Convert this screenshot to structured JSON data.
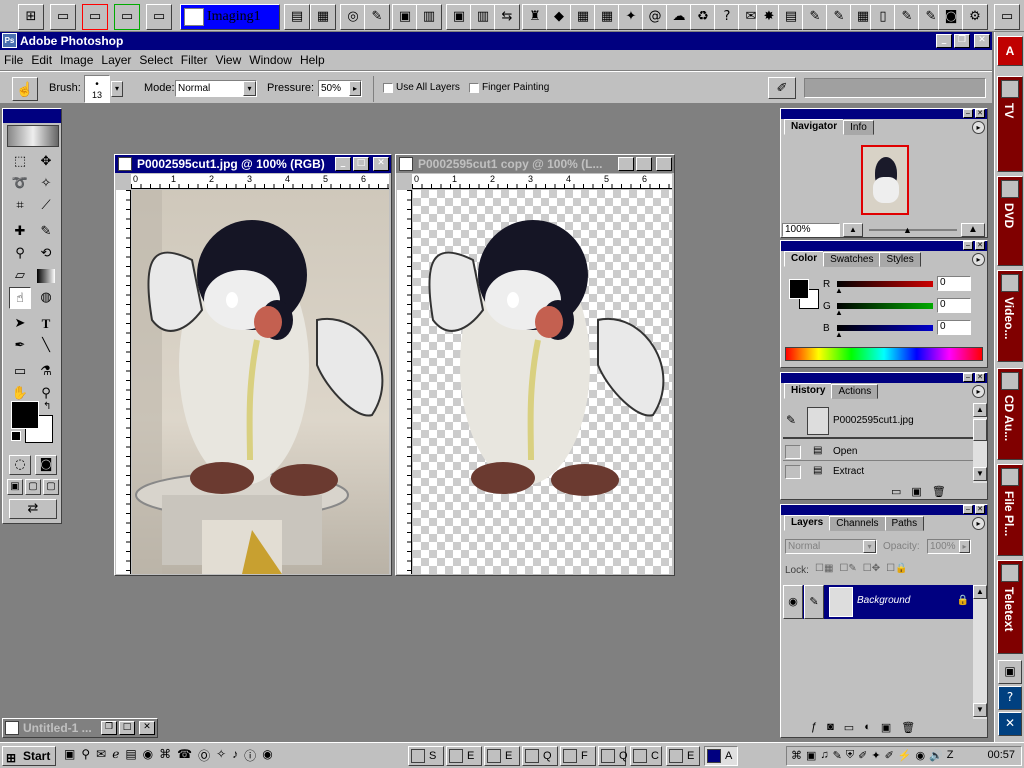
{
  "top_shortcut_bar": {
    "active_folder_label": "Imaging1"
  },
  "app": {
    "title": "Adobe Photoshop",
    "menu": [
      "File",
      "Edit",
      "Image",
      "Layer",
      "Select",
      "Filter",
      "View",
      "Window",
      "Help"
    ]
  },
  "options_bar": {
    "brush_label": "Brush:",
    "brush_size": "13",
    "mode_label": "Mode:",
    "mode_value": "Normal",
    "pressure_label": "Pressure:",
    "pressure_value": "50%",
    "use_all_layers_label": "Use All Layers",
    "use_all_layers_checked": false,
    "finger_painting_label": "Finger Painting",
    "finger_painting_checked": false
  },
  "documents": [
    {
      "title": "P0002595cut1.jpg @ 100% (RGB)",
      "active": true
    },
    {
      "title": "P0002595cut1 copy @ 100% (L...",
      "active": false
    }
  ],
  "ruler_numbers": [
    "0",
    "1",
    "2",
    "3",
    "4",
    "5",
    "6"
  ],
  "navigator": {
    "tabs": [
      "Navigator",
      "Info"
    ],
    "zoom": "100%"
  },
  "color": {
    "tabs": [
      "Color",
      "Swatches",
      "Styles"
    ],
    "channels": [
      {
        "label": "R",
        "value": "0",
        "color": "#cc0000"
      },
      {
        "label": "G",
        "value": "0",
        "color": "#00aa00"
      },
      {
        "label": "B",
        "value": "0",
        "color": "#0000cc"
      }
    ]
  },
  "history": {
    "tabs": [
      "History",
      "Actions"
    ],
    "snapshot": "P0002595cut1.jpg",
    "steps": [
      "Open",
      "Extract"
    ]
  },
  "layers": {
    "tabs": [
      "Layers",
      "Channels",
      "Paths"
    ],
    "blend_mode": "Normal",
    "opacity_label": "Opacity:",
    "opacity_value": "100%",
    "lock_label": "Lock:",
    "layer_name": "Background"
  },
  "minimized_window": {
    "title": "Untitled-1 ..."
  },
  "taskbar": {
    "start_label": "Start",
    "tasks": [
      "S",
      "E",
      "E",
      "Q",
      "F",
      "Q",
      "C",
      "E",
      "A"
    ],
    "clock": "00:57"
  },
  "sidebar": {
    "buttons": [
      "TV",
      "DVD",
      "Video...",
      "CD Au...",
      "File Pl...",
      "Teletext"
    ]
  },
  "colors": {
    "title_active": "#000080",
    "title_inactive": "#808080",
    "desktop": "#808080"
  }
}
